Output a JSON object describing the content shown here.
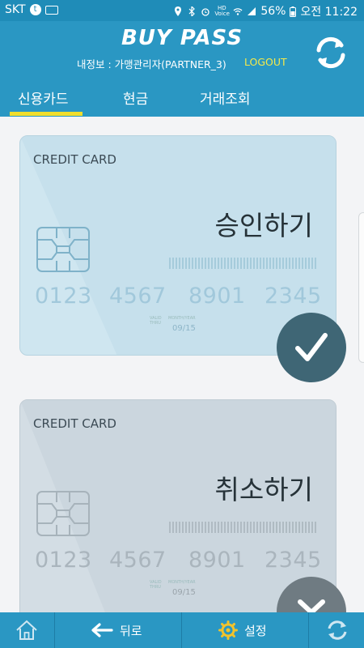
{
  "status_bar": {
    "carrier": "SKT",
    "battery": "56%",
    "time": "오전 11:22",
    "volte": "HD Voice"
  },
  "header": {
    "logo": "BUY PASS",
    "user_info": "내정보 : 가맹관리자(PARTNER_3)",
    "logout": "LOGOUT"
  },
  "tabs": [
    {
      "label": "신용카드",
      "active": true
    },
    {
      "label": "현금",
      "active": false
    },
    {
      "label": "거래조회",
      "active": false
    }
  ],
  "cards": [
    {
      "label": "CREDIT CARD",
      "action": "승인하기",
      "number_groups": [
        "0123",
        "4567",
        "8901",
        "2345"
      ],
      "valid_thru": "VALID\nTHRU",
      "month_year": "MONTH/YEAR",
      "expiry": "09/15"
    },
    {
      "label": "CREDIT CARD",
      "action": "취소하기",
      "number_groups": [
        "0123",
        "4567",
        "8901",
        "2345"
      ],
      "valid_thru": "VALID\nTHRU",
      "month_year": "MONTH/YEAR",
      "expiry": "09/15"
    }
  ],
  "bottom_bar": {
    "back": "뒤로",
    "settings": "설정"
  },
  "colors": {
    "primary": "#2a97c3",
    "accent_yellow": "#f1de2c",
    "logout": "#f5e94a"
  },
  "icons": {
    "home": "home-icon",
    "back": "arrow-left-icon",
    "settings": "gear-icon",
    "refresh": "refresh-icon",
    "check": "check-icon",
    "down": "chevron-down-icon"
  }
}
